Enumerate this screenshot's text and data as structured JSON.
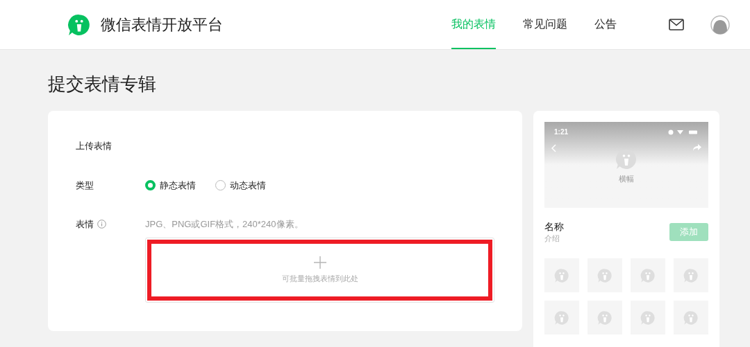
{
  "header": {
    "logo_text": "微信表情开放平台",
    "nav": [
      {
        "label": "我的表情",
        "selected": true
      },
      {
        "label": "常见问题",
        "selected": false
      },
      {
        "label": "公告",
        "selected": false
      }
    ]
  },
  "page_title": "提交表情专辑",
  "form": {
    "section_title": "上传表情",
    "type_label": "类型",
    "type_options": [
      {
        "label": "静态表情",
        "selected": true
      },
      {
        "label": "动态表情",
        "selected": false
      }
    ],
    "sticker_label": "表情",
    "hint": "JPG、PNG或GIF格式，240*240像素。",
    "dropzone": {
      "text": "可批量拖拽表情到此处",
      "annotated": true
    }
  },
  "preview": {
    "status_time": "1:21",
    "banner_label": "横幅",
    "name": "名称",
    "intro": "介绍",
    "add_button": "添加",
    "tiles": [
      {
        "kind": "sticker"
      },
      {
        "kind": "sticker"
      },
      {
        "kind": "sticker"
      },
      {
        "kind": "sticker"
      },
      {
        "kind": "sticker"
      },
      {
        "kind": "sticker"
      },
      {
        "kind": "sticker"
      },
      {
        "kind": "sticker"
      }
    ]
  }
}
